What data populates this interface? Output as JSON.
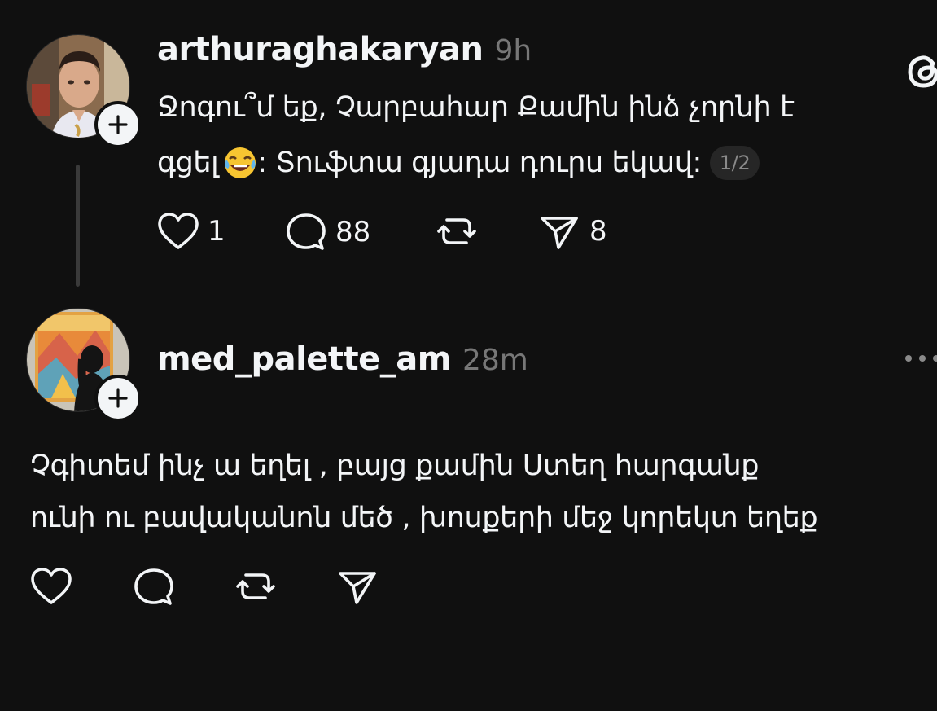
{
  "posts": [
    {
      "username": "arthuraghakaryan",
      "time": "9h",
      "text_line1": "Ջոգու՞մ եք, Չարբահար Քամին ինձ չորնի է",
      "text_line2_part1": "գցել",
      "emoji": "face-with-tears-of-joy",
      "text_line2_part2": ": Տուֆտա գյադա դուրս եկավ:",
      "page_indicator": "1/2",
      "likes": "1",
      "replies": "88",
      "shares": "8"
    },
    {
      "username": "med_palette_am",
      "time": "28m",
      "text_line1": "Չգիտեմ ինչ ա եղել , բայց  քամին  Ստեղ հարգանք",
      "text_line2": "ունի ու բավականոն մեծ , խոսքերի մեջ կորեկտ եղեք"
    }
  ],
  "icons": {
    "threads_logo": "threads-logo-icon",
    "like": "heart-icon",
    "reply": "comment-bubble-icon",
    "repost": "repost-icon",
    "share": "send-icon",
    "more": "more-horizontal-icon",
    "follow": "plus-icon"
  },
  "colors": {
    "background": "#101010",
    "text": "#f3f5f7",
    "muted": "#777777",
    "pill_bg": "#262626"
  }
}
